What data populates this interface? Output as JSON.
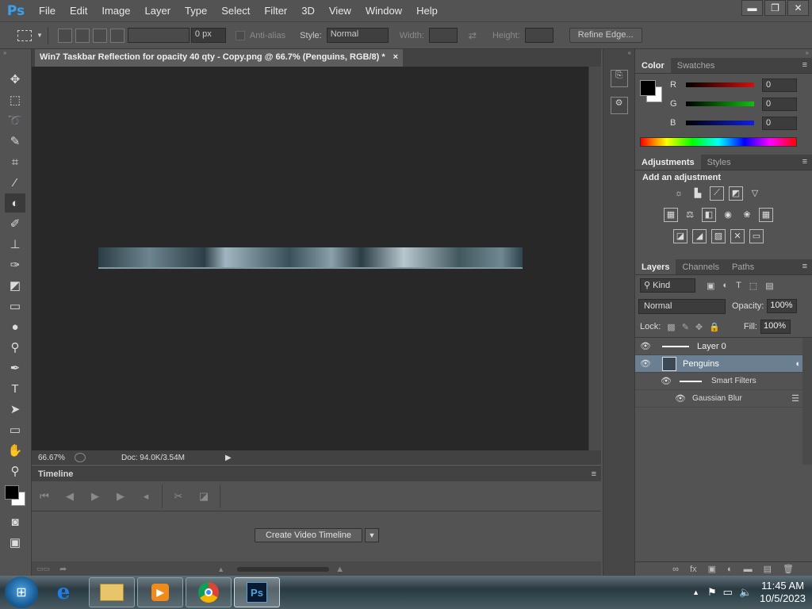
{
  "app": {
    "logo": "Ps"
  },
  "menu": [
    "File",
    "Edit",
    "Image",
    "Layer",
    "Type",
    "Select",
    "Filter",
    "3D",
    "View",
    "Window",
    "Help"
  ],
  "window_controls": {
    "minimize": "▬",
    "restore": "❐",
    "close": "✕"
  },
  "options_bar": {
    "feather_value": "0 px",
    "anti_alias_label": "Anti-alias",
    "style_label": "Style:",
    "style_value": "Normal",
    "width_label": "Width:",
    "height_label": "Height:",
    "refine_edge_label": "Refine Edge..."
  },
  "document": {
    "tab_title": "Win7 Taskbar Reflection for opacity 40 qty  - Copy.png @ 66.7% (Penguins, RGB/8) *",
    "close": "×",
    "zoom": "66.67%",
    "doc_info": "Doc: 94.0K/3.54M"
  },
  "timeline": {
    "title": "Timeline",
    "create_button": "Create Video Timeline"
  },
  "color_panel": {
    "tabs": [
      "Color",
      "Swatches"
    ],
    "channels": [
      {
        "label": "R",
        "value": "0",
        "color": "#d01010"
      },
      {
        "label": "G",
        "value": "0",
        "color": "#10c010"
      },
      {
        "label": "B",
        "value": "0",
        "color": "#1020e0"
      }
    ]
  },
  "adjustments_panel": {
    "tabs": [
      "Adjustments",
      "Styles"
    ],
    "heading": "Add an adjustment"
  },
  "layers_panel": {
    "tabs": [
      "Layers",
      "Channels",
      "Paths"
    ],
    "filter_kind": "Kind",
    "blend_mode": "Normal",
    "opacity_label": "Opacity:",
    "opacity_value": "100%",
    "lock_label": "Lock:",
    "fill_label": "Fill:",
    "fill_value": "100%",
    "layers": [
      {
        "name": "Layer 0"
      },
      {
        "name": "Penguins"
      },
      {
        "name": "Smart Filters"
      },
      {
        "name": "Gaussian Blur"
      }
    ]
  },
  "taskbar": {
    "ps_label": "Ps",
    "time": "11:45 AM",
    "date": "10/5/2023"
  }
}
